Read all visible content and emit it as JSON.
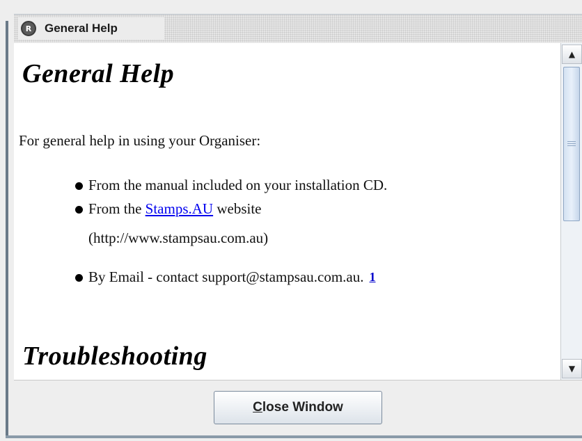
{
  "window": {
    "title": "General Help",
    "app_icon": "app-logo-icon"
  },
  "content": {
    "heading": "General Help",
    "intro": "For general help in using your Organiser:",
    "bullets": [
      {
        "text": "From the manual included on your installation CD."
      },
      {
        "prefix": "From the ",
        "link_text": "Stamps.AU",
        "suffix": " website",
        "line2": "(http://www.stampsau.com.au)"
      },
      {
        "text": "By Email - contact support@stampsau.com.au.",
        "footnote": "1"
      }
    ],
    "heading2": "Troubleshooting"
  },
  "scrollbar": {
    "up_icon": "scroll-up-arrow-icon",
    "down_icon": "scroll-down-arrow-icon"
  },
  "footer": {
    "close_button_mnemonic": "C",
    "close_button_rest": "lose Window"
  },
  "colors": {
    "link": "#0000ee",
    "scroll_thumb": "#d4e2f2"
  }
}
